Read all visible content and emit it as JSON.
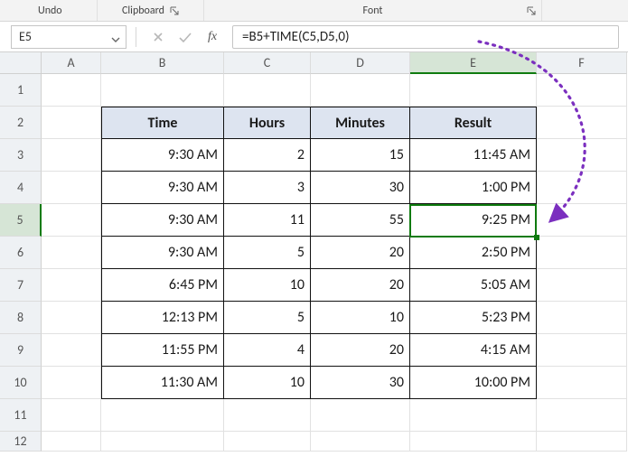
{
  "ribbon": {
    "undo": "Undo",
    "clipboard": "Clipboard",
    "font": "Font"
  },
  "formula_bar": {
    "cell_ref": "E5",
    "formula": "=B5+TIME(C5,D5,0)"
  },
  "columns": [
    "A",
    "B",
    "C",
    "D",
    "E",
    "F"
  ],
  "rows": [
    "1",
    "2",
    "3",
    "4",
    "5",
    "6",
    "7",
    "8",
    "9",
    "10",
    "11",
    "12"
  ],
  "headers": {
    "b": "Time",
    "c": "Hours",
    "d": "Minutes",
    "e": "Result"
  },
  "data": [
    {
      "b": "9:30 AM",
      "c": "2",
      "d": "15",
      "e": "11:45 AM"
    },
    {
      "b": "9:30 AM",
      "c": "3",
      "d": "30",
      "e": "1:00 PM"
    },
    {
      "b": "9:30 AM",
      "c": "11",
      "d": "55",
      "e": "9:25 PM"
    },
    {
      "b": "9:30 AM",
      "c": "5",
      "d": "20",
      "e": "2:50 PM"
    },
    {
      "b": "6:45 PM",
      "c": "10",
      "d": "20",
      "e": "5:05 AM"
    },
    {
      "b": "12:13 PM",
      "c": "5",
      "d": "10",
      "e": "5:23 PM"
    },
    {
      "b": "11:55 PM",
      "c": "4",
      "d": "20",
      "e": "4:15 AM"
    },
    {
      "b": "11:30 AM",
      "c": "10",
      "d": "30",
      "e": "10:00 PM"
    }
  ],
  "selection": {
    "col": "E",
    "row": 5
  },
  "annotation_arrow": {
    "from": "formula_bar",
    "to": "E5",
    "color": "#7b2fbf",
    "style": "dotted"
  }
}
